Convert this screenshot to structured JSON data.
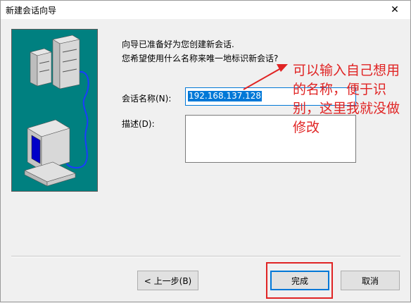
{
  "window": {
    "title": "新建会话向导",
    "close_glyph": "✕"
  },
  "intro": {
    "line1": "向导已准备好为您创建新会话.",
    "line2": "您希望使用什么名称来唯一地标识新会话?"
  },
  "form": {
    "name_label": "会话名称(N):",
    "name_value": "192.168.137.128",
    "desc_label": "描述(D):",
    "desc_value": ""
  },
  "annotation": {
    "text": "可以输入自己想用的名称，便于识别，这里我就没做修改",
    "color": "#e02424"
  },
  "buttons": {
    "back": "< 上一步(B)",
    "finish": "完成",
    "cancel": "取消"
  },
  "colors": {
    "illustration_bg": "#008080",
    "selection": "#0078d7",
    "annotation": "#e02424"
  },
  "icons": [
    "server-icon",
    "computer-icon",
    "cable-icon",
    "close-icon",
    "arrow-icon"
  ]
}
